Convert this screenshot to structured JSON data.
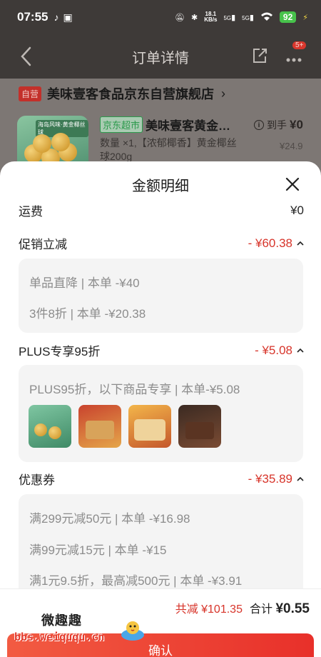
{
  "status_bar": {
    "time": "07:55",
    "net_speed_top": "18.1",
    "net_speed_bottom": "KB/s",
    "signal_1": "5G",
    "signal_2": "5G",
    "battery": "92"
  },
  "nav": {
    "title": "订单详情",
    "badge": "5+"
  },
  "order": {
    "self_tag": "自营",
    "store_name": "美味壹客食品京东自营旗舰店",
    "product_tag": "京东超市",
    "product_name": "美味壹客黄金…",
    "product_desc": "数量 ×1,【浓郁椰香】黄金椰丝球200g",
    "price_label": "到手",
    "price_value": "¥0",
    "orig_price": "¥24.9",
    "img_label": "海岛风味·黄金椰丝球"
  },
  "sheet": {
    "title": "金额明细",
    "shipping": {
      "label": "运费",
      "value": "¥0"
    },
    "promo": {
      "label": "促销立减",
      "value": "- ¥60.38",
      "items": [
        "单品直降 | 本单 -¥40",
        "3件8折 | 本单 -¥20.38"
      ]
    },
    "plus": {
      "label": "PLUS专享95折",
      "value": "- ¥5.08",
      "items": [
        "PLUS95折，以下商品专享 | 本单-¥5.08"
      ]
    },
    "coupon": {
      "label": "优惠券",
      "value": "- ¥35.89",
      "items": [
        "满299元减50元 | 本单 -¥16.98",
        "满99元减15元 | 本单 -¥15",
        "满1元9.5折，最高减500元 | 本单 -¥3.91"
      ]
    }
  },
  "footer": {
    "total_reduce": "共减 ¥101.35",
    "sum_label": "合计",
    "sum_value": "¥0.55",
    "confirm": "确认"
  },
  "watermark": {
    "brand": "微趣趣",
    "url": "bbs.weiququ.cn"
  },
  "colors": {
    "accent_red": "#d7342a",
    "button_red": "#e8302a",
    "mart_green": "#2c9a4c"
  }
}
